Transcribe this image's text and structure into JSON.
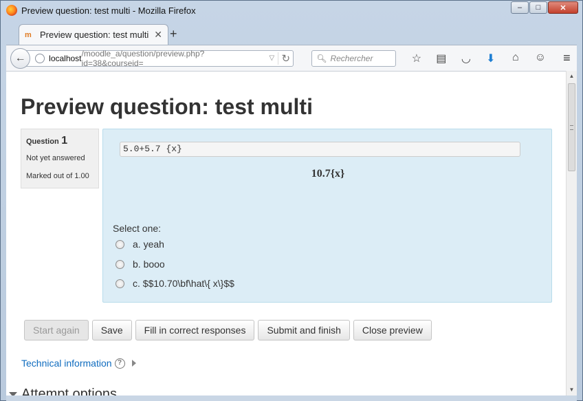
{
  "window": {
    "title": "Preview question: test multi - Mozilla Firefox",
    "controls": {
      "minimize": "–",
      "maximize": "□",
      "close": "✕"
    }
  },
  "tabs": [
    {
      "label": "Preview question: test multi",
      "close": "✕"
    }
  ],
  "newtab": "+",
  "navbar": {
    "url_host": "localhost",
    "url_path": "/moodle_a/question/preview.php?id=38&courseid=",
    "search_placeholder": "Rechercher"
  },
  "page": {
    "title": "Preview question: test multi"
  },
  "question_info": {
    "label": "Question",
    "number": "1",
    "state": "Not yet answered",
    "grade": "Marked out of 1.00"
  },
  "formulation": {
    "code": "5.0+5.7 {x}",
    "math": "10.7{x}",
    "prompt": "Select one:",
    "answers": [
      {
        "label": "a. yeah"
      },
      {
        "label": "b. booo"
      },
      {
        "label": "c. $$10.70\\bf\\hat\\{ x\\}$$"
      }
    ]
  },
  "buttons": {
    "start_again": "Start again",
    "save": "Save",
    "fill_correct": "Fill in correct responses",
    "submit_finish": "Submit and finish",
    "close_preview": "Close preview"
  },
  "technical_info": "Technical information",
  "attempt_options": "Attempt options",
  "colors": {
    "formulation_bg": "#dcedf6",
    "link": "#0f6cbf",
    "info_bg": "#f0f0f0"
  }
}
